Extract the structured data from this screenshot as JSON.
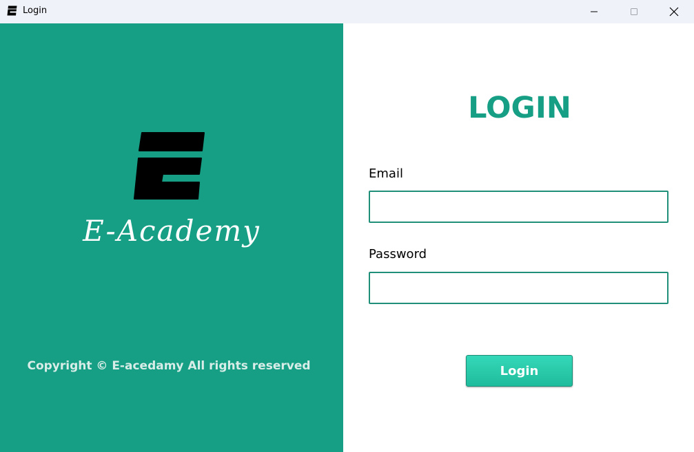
{
  "window": {
    "title": "Login",
    "app_icon": "e-academy-logo-icon",
    "controls": {
      "minimize_icon": "minimize-icon",
      "maximize_icon": "maximize-icon",
      "close_icon": "close-icon"
    }
  },
  "branding": {
    "logo_icon": "e-letter-logo-icon",
    "name": "E-Academy",
    "copyright": "Copyright © E-acedamy All rights reserved"
  },
  "form": {
    "heading": "LOGIN",
    "email": {
      "label": "Email",
      "value": "",
      "placeholder": ""
    },
    "password": {
      "label": "Password",
      "value": "",
      "placeholder": ""
    },
    "submit_label": "Login"
  },
  "colors": {
    "brand_green": "#179f85",
    "button_green": "#2ccfaf",
    "titlebar_bg": "#eff2f9",
    "input_border": "#1f8f7a"
  }
}
